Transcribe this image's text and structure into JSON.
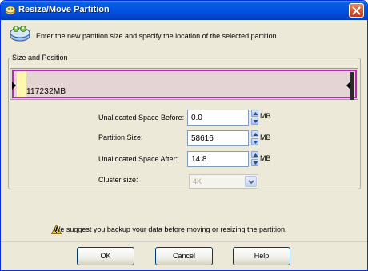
{
  "window": {
    "title": "Resize/Move Partition",
    "title_icon": "partition-app-icon",
    "close_icon": "close-icon"
  },
  "banner": {
    "icon": "partition-disks-icon",
    "text": "Enter the new partition size and specify the location of the selected partition."
  },
  "group": {
    "label": "Size and Position"
  },
  "partition_bar": {
    "label": "117232MB",
    "frame_color": "#b030b0",
    "fill_color": "#fff7b0",
    "background_color": "#e4d4d4"
  },
  "fields": {
    "before": {
      "label": "Unallocated Space Before:",
      "value": "0.0",
      "unit": "MB"
    },
    "size": {
      "label": "Partition Size:",
      "value": "58616",
      "unit": "MB"
    },
    "after": {
      "label": "Unallocated Space After:",
      "value": "14.8",
      "unit": "MB"
    },
    "cluster": {
      "label": "Cluster size:",
      "value": "4K"
    }
  },
  "warning": {
    "icon": "warning-icon",
    "text": "We suggest you backup your data before moving or resizing the partition."
  },
  "buttons": {
    "ok": "OK",
    "cancel": "Cancel",
    "help": "Help"
  },
  "colors": {
    "titlebar": "#0054e3",
    "dialog_bg": "#ece9d8",
    "close_button": "#d6562f"
  }
}
